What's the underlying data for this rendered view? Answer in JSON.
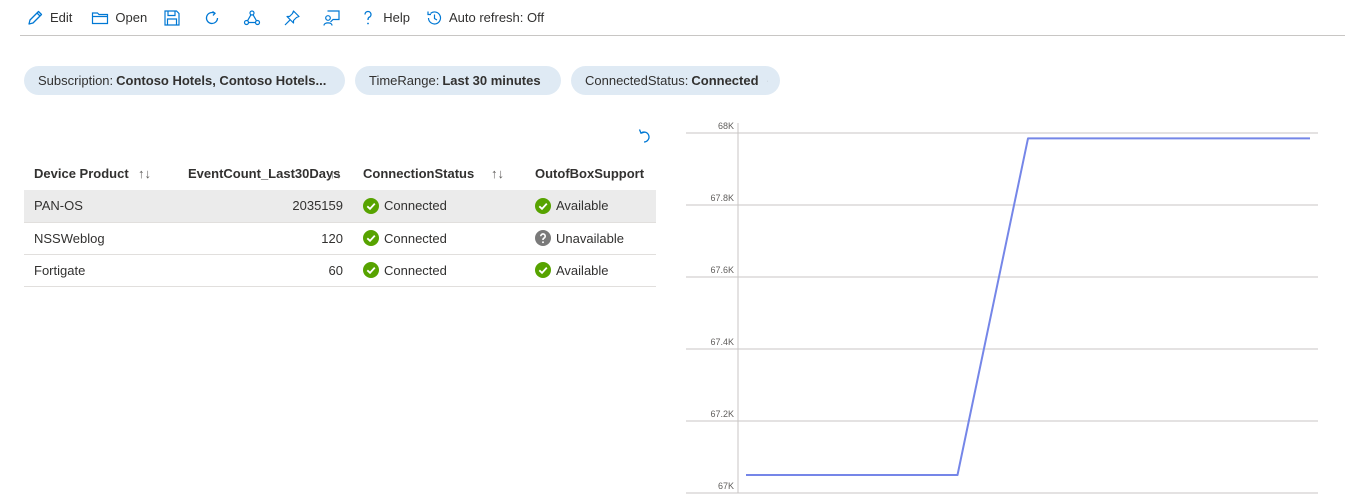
{
  "toolbar": {
    "edit_label": "Edit",
    "open_label": "Open",
    "help_label": "Help",
    "auto_refresh_label": "Auto refresh: Off"
  },
  "filters": [
    {
      "key": "Subscription:",
      "value": "Contoso Hotels, Contoso Hotels..."
    },
    {
      "key": "TimeRange:",
      "value": "Last 30 minutes"
    },
    {
      "key": "ConnectedStatus:",
      "value": "Connected"
    }
  ],
  "table": {
    "columns": [
      "Device Product",
      "EventCount_Last30Days",
      "ConnectionStatus",
      "OutofBoxSupport"
    ],
    "sort_glyph": "↑↓",
    "rows": [
      {
        "product": "PAN-OS",
        "count": "2035159",
        "status": "Connected",
        "support": "Available",
        "support_ok": true
      },
      {
        "product": "NSSWeblog",
        "count": "120",
        "status": "Connected",
        "support": "Unavailable",
        "support_ok": false
      },
      {
        "product": "Fortigate",
        "count": "60",
        "status": "Connected",
        "support": "Available",
        "support_ok": true
      }
    ]
  },
  "colors": {
    "accent": "#0078d4",
    "ok_green": "#57a300",
    "unknown_gray": "#7a7a7a",
    "line": "#7586e8",
    "pill_bg": "#dfeaf4"
  },
  "chart_data": {
    "type": "line",
    "title": "",
    "xlabel": "",
    "ylabel": "",
    "ylim": [
      67000,
      68000
    ],
    "y_ticks": [
      "68K",
      "67.8K",
      "67.6K",
      "67.4K",
      "67.2K",
      "67K"
    ],
    "y_tick_values": [
      68000,
      67800,
      67600,
      67400,
      67200,
      67000
    ],
    "x_labels_visible": false,
    "grid": true,
    "series": [
      {
        "values": [
          67050,
          67050,
          67050,
          67050,
          67985,
          67985,
          67985,
          67985,
          67985
        ]
      }
    ]
  }
}
